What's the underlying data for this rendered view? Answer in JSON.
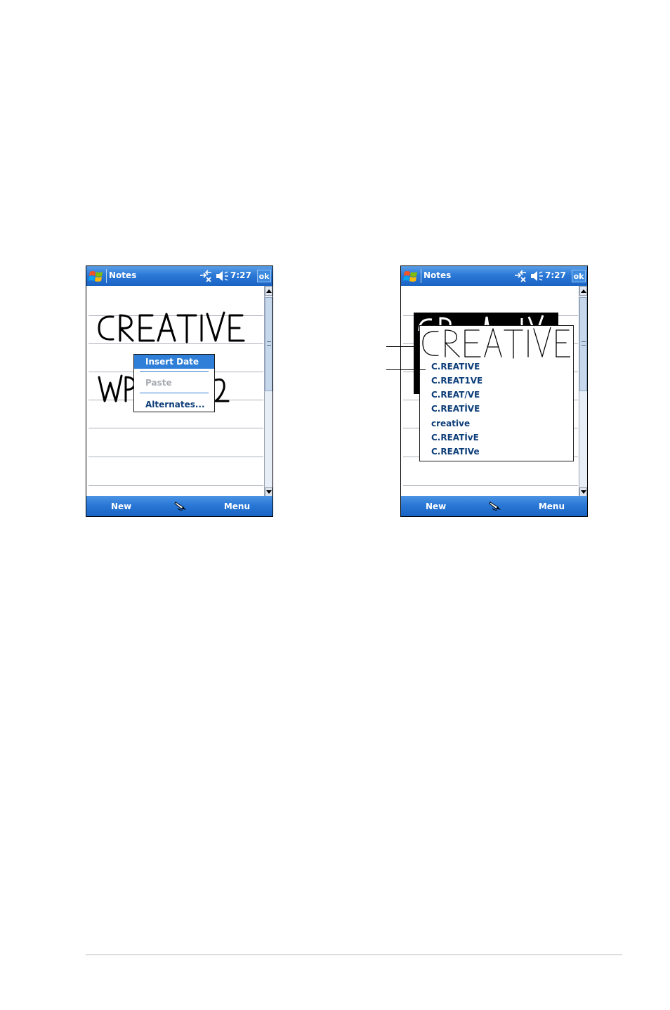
{
  "screens": [
    {
      "title": "Notes",
      "clock": "7:27",
      "ok_label": "ok",
      "menubar": {
        "new_label": "New",
        "menu_label": "Menu"
      },
      "context_menu": {
        "items": [
          "Insert Date",
          "Paste",
          "Alternates..."
        ]
      }
    },
    {
      "title": "Notes",
      "clock": "7:27",
      "ok_label": "ok",
      "menubar": {
        "new_label": "New",
        "menu_label": "Menu"
      },
      "alternates": [
        "C.REATIVE",
        "C.REAT1VE",
        "C.REAT/VE",
        "C.REATİVE",
        "creative",
        "C.REATİvE",
        "C.REATIVe"
      ]
    }
  ],
  "colors": {
    "titlebar": "#2a78d6",
    "menu_highlight": "#2f7fd8",
    "menu_text": "#0c3d78",
    "disabled_text": "#a8acb2"
  },
  "icons": [
    "windows-start-icon",
    "connectivity-icon",
    "speaker-muted-icon",
    "pen-input-icon",
    "scroll-up-icon",
    "scroll-down-icon"
  ]
}
